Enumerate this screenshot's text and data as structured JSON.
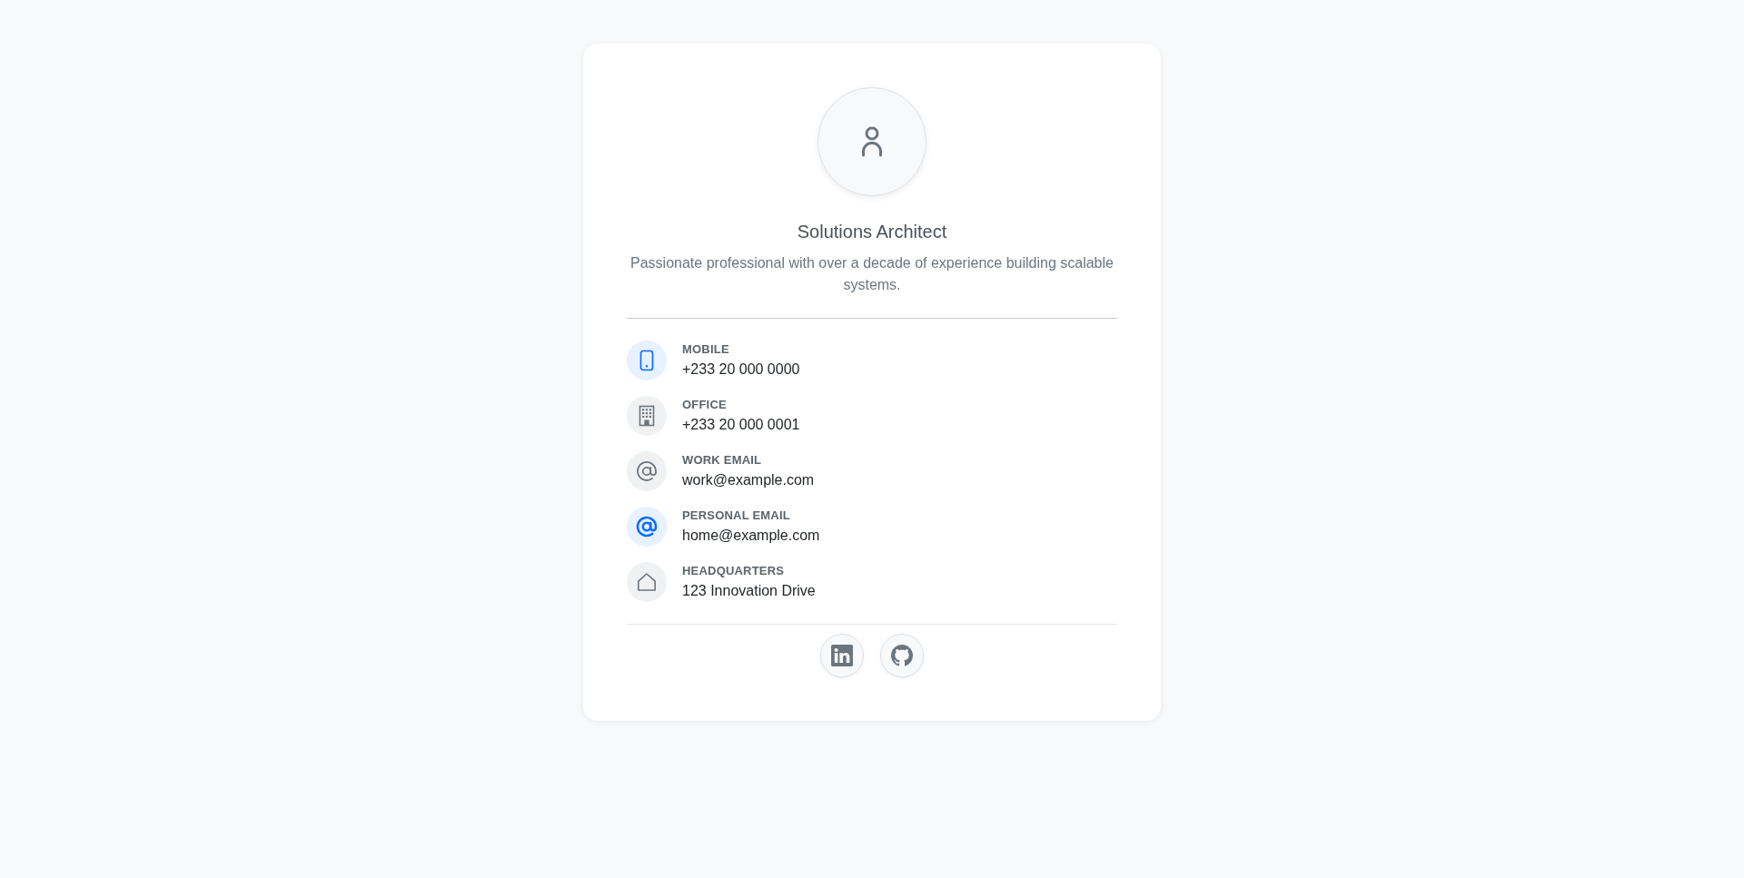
{
  "profile": {
    "title": "Solutions Architect",
    "bio": "Passionate professional with over a decade of experience building scalable systems."
  },
  "contacts": [
    {
      "label": "MOBILE",
      "value": "+233 20 000 0000",
      "highlighted": true
    },
    {
      "label": "OFFICE",
      "value": "+233 20 000 0001",
      "highlighted": false
    },
    {
      "label": "WORK EMAIL",
      "value": "work@example.com",
      "highlighted": false
    },
    {
      "label": "PERSONAL EMAIL",
      "value": "home@example.com",
      "highlighted": true
    },
    {
      "label": "HEADQUARTERS",
      "value": "123 Innovation Drive",
      "highlighted": false
    }
  ]
}
